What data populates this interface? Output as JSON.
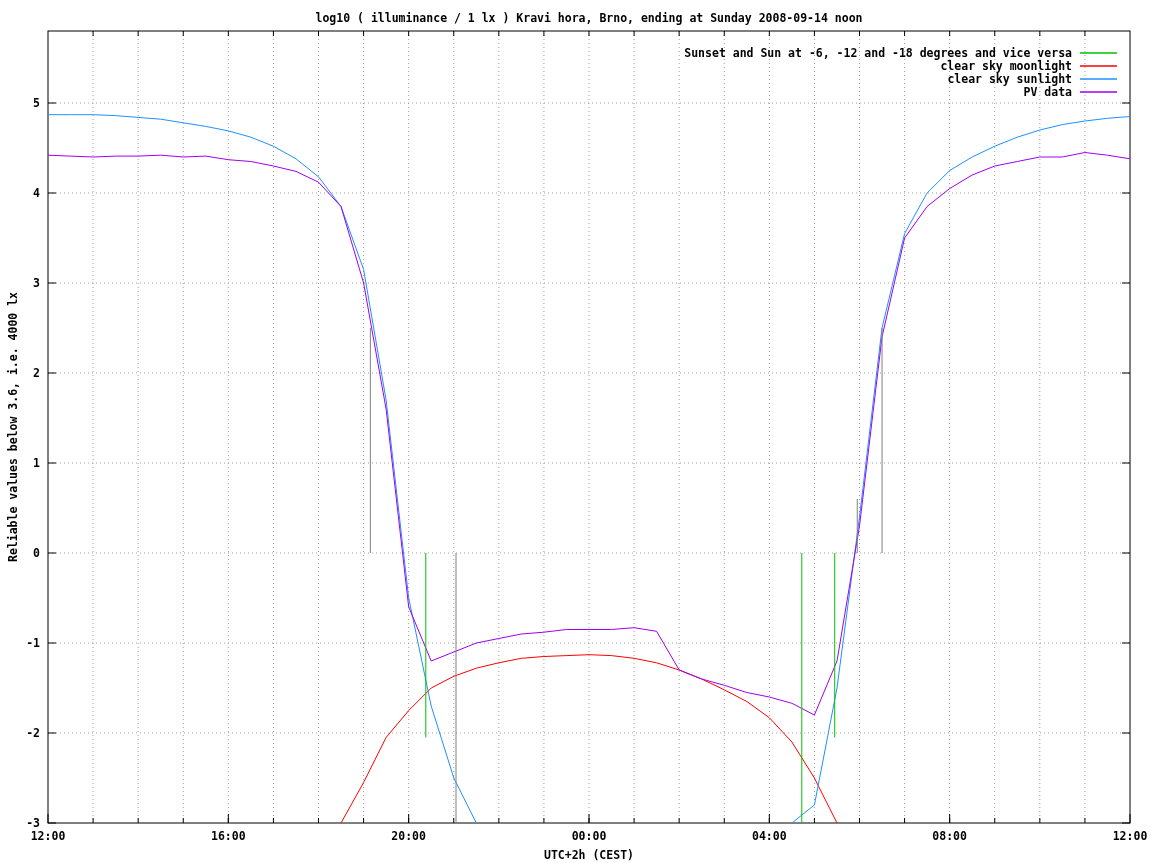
{
  "chart_data": {
    "type": "line",
    "title": "log10 ( illuminance / 1 lx ) Kravi hora, Brno, ending at Sunday 2008-09-14 noon",
    "xlabel": "UTC+2h (CEST)",
    "ylabel": "Reliable values below 3.6, i.e. 4000 lx",
    "categories": [
      "12:00",
      null,
      null,
      null,
      null,
      null,
      null,
      null,
      "16:00",
      null,
      null,
      null,
      null,
      null,
      null,
      null,
      "20:00",
      null,
      null,
      null,
      null,
      null,
      null,
      null,
      "00:00",
      null,
      null,
      null,
      null,
      null,
      null,
      null,
      "04:00",
      null,
      null,
      null,
      null,
      null,
      null,
      null,
      "08:00",
      null,
      null,
      null,
      null,
      null,
      null,
      null,
      "12:00"
    ],
    "series": [
      {
        "name": "Sunset and Sun at -6, -12 and -18 degrees and vice versa",
        "color": "#00c000",
        "values": [
          null,
          null,
          null,
          null,
          null,
          null,
          null,
          null,
          null,
          null,
          null,
          null,
          null,
          null,
          null,
          null,
          null,
          null,
          null,
          null,
          null,
          null,
          null,
          null,
          null,
          null,
          null,
          null,
          null,
          null,
          null,
          null,
          null,
          null,
          null,
          null,
          null,
          null,
          null,
          null,
          null,
          null,
          null,
          null,
          null,
          null,
          null,
          null,
          null
        ]
      },
      {
        "name": "clear sky moonlight",
        "color": "#ff0000",
        "values": [
          null,
          null,
          null,
          null,
          null,
          null,
          null,
          null,
          null,
          null,
          null,
          null,
          null,
          -3.0,
          -2.55,
          -2.05,
          -1.75,
          -1.5,
          -1.37,
          -1.28,
          -1.22,
          -1.17,
          -1.15,
          -1.14,
          -1.13,
          -1.14,
          -1.17,
          -1.22,
          -1.3,
          -1.4,
          -1.52,
          -1.65,
          -1.83,
          -2.1,
          -2.5,
          -3.0,
          null,
          null,
          null,
          null,
          null,
          null,
          null,
          null,
          null,
          null,
          null,
          null,
          null
        ]
      },
      {
        "name": "clear sky sunlight",
        "color": "#1e90ff",
        "values": [
          4.87,
          4.87,
          4.87,
          4.86,
          4.84,
          4.82,
          4.78,
          4.74,
          4.69,
          4.62,
          4.52,
          4.38,
          4.18,
          3.85,
          3.15,
          1.7,
          -0.5,
          -1.7,
          -2.5,
          -3.0,
          null,
          null,
          null,
          null,
          null,
          null,
          null,
          null,
          null,
          null,
          null,
          null,
          null,
          -3.0,
          -2.8,
          -1.5,
          0.4,
          2.5,
          3.55,
          4.0,
          4.25,
          4.4,
          4.52,
          4.62,
          4.7,
          4.76,
          4.8,
          4.83,
          4.85
        ]
      },
      {
        "name": "PV data",
        "color": "#a000f0",
        "values": [
          4.42,
          4.41,
          4.4,
          4.41,
          4.41,
          4.42,
          4.4,
          4.41,
          4.37,
          4.35,
          4.3,
          4.24,
          4.12,
          3.85,
          3.0,
          1.6,
          -0.6,
          -1.2,
          -1.1,
          -1.0,
          -0.95,
          -0.9,
          -0.88,
          -0.85,
          -0.85,
          -0.85,
          -0.83,
          -0.87,
          -1.3,
          -1.4,
          -1.47,
          -1.55,
          -1.6,
          -1.67,
          -1.8,
          -1.2,
          0.3,
          2.4,
          3.5,
          3.85,
          4.05,
          4.2,
          4.3,
          4.35,
          4.4,
          4.4,
          4.45,
          4.42,
          4.38
        ]
      }
    ],
    "ylim": [
      -3,
      5.8
    ],
    "yticks": [
      -3,
      -2,
      -1,
      0,
      1,
      2,
      3,
      4,
      5
    ],
    "grid": true,
    "legend": true
  }
}
